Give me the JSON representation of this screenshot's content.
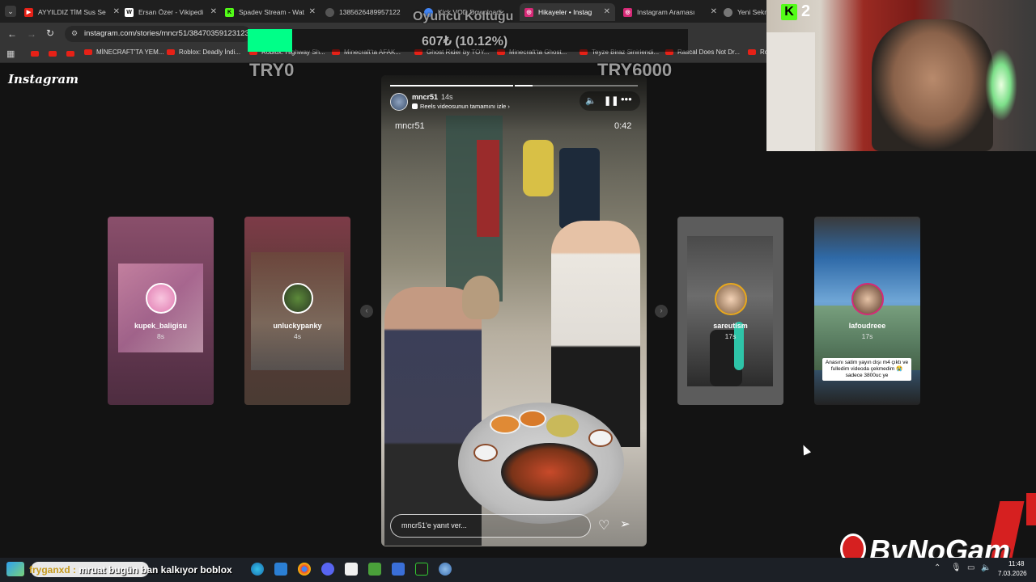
{
  "tabs": [
    {
      "title": "AYYILDIZ TİM Sus Se",
      "icon": "youtube-icon"
    },
    {
      "title": "Ersan Özer - Vikipedi",
      "icon": "wikipedia-icon"
    },
    {
      "title": "Spadev Stream - Wat",
      "icon": "kick-icon"
    },
    {
      "title": "1385626489957122",
      "icon": "globe-icon"
    },
    {
      "title": "Kick VOD Downloadi",
      "icon": "chrome-icon"
    },
    {
      "title": "Hikayeler • Instag",
      "icon": "instagram-icon"
    },
    {
      "title": "Instagram Araması",
      "icon": "instagram-icon"
    },
    {
      "title": "Yeni Sekme",
      "icon": "chrome-icon"
    }
  ],
  "address": {
    "url": "instagram.com/stories/mncr51/38470359123123"
  },
  "bookmarks": [
    {
      "label": "MİNECRAFT'TA YEM..."
    },
    {
      "label": "Roblox: Deadly İndi..."
    },
    {
      "label": "Roblox: Highway Sh..."
    },
    {
      "label": "Minecraft'ta AFAK..."
    },
    {
      "label": "Ghost Rider by TOY..."
    },
    {
      "label": "Minecraft'ta Ghost..."
    },
    {
      "label": "Teyze Biraz Sinirlendi..."
    },
    {
      "label": "Rascal Does Not Dr..."
    },
    {
      "label": "Ro"
    }
  ],
  "overlay": {
    "title": "Oyuncu Koltuğu",
    "amount": "607₺ (10.12%)",
    "left_label": "TRY0",
    "right_label": "TRY6000",
    "progress_fraction": 0.1012
  },
  "app": {
    "logo": "Instagram"
  },
  "story": {
    "username": "mncr51",
    "time": "14s",
    "reels_link": "Reels videosunun tamamını izle",
    "video_user": "mncr51",
    "duration": "0:42",
    "reply_placeholder": "mncr51'e yanıt ver..."
  },
  "side_stories": [
    {
      "username": "kupek_baligisu",
      "age": "8s"
    },
    {
      "username": "unluckypanky",
      "age": "4s"
    },
    {
      "username": "sareutism",
      "age": "17s"
    },
    {
      "username": "lafoudreee",
      "age": "17s",
      "caption": "Anasını satim yayın dışı m4 çıktı ve fulledim videoda çekmedim 😭 sadece 3800uc ye"
    }
  ],
  "webcam": {
    "kick_count": "2"
  },
  "brand": {
    "watermark": "ByNoGam"
  },
  "taskbar": {
    "chat_user": "fryganxd :",
    "chat_message": "mruat bugün ban kalkıyor boblox",
    "time": "11:48",
    "date": "7.03.2026"
  },
  "colors": {
    "accent_green": "#00ff88",
    "kick_green": "#53fc18",
    "instagram_gradient": "#d62976",
    "youtube_red": "#e62117"
  }
}
